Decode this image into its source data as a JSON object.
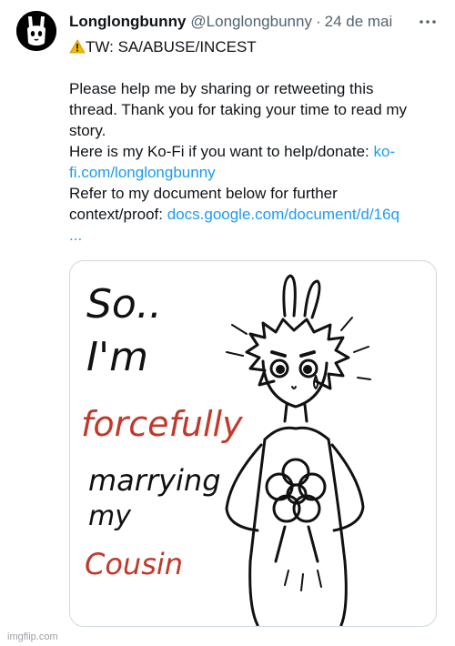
{
  "tweet": {
    "display_name": "Longlongbunny",
    "handle": "@Longlongbunny",
    "separator": "·",
    "date": "24 de mai",
    "warning_icon": "warning-icon",
    "warning_text": "TW: SA/ABUSE/INCEST",
    "lines": {
      "l1": "Please help me by sharing or retweeting this",
      "l2": "thread. Thank you for taking your time to read my",
      "l3": "story.",
      "l4_text": "Here is my Ko-Fi if you want to help/donate: ",
      "l4_link": "ko-",
      "l5_link": "fi.com/longlongbunny",
      "l6": "Refer to my document below for further",
      "l7_text": "context/proof: ",
      "l7_link": "docs.google.com/document/d/16q",
      "l8_link": "..."
    }
  },
  "media": {
    "text_lines": [
      "So..",
      "I'm",
      "forcefully",
      "marrying",
      "my",
      "Cousin"
    ],
    "accent_color": "#c0392b"
  },
  "colors": {
    "link": "#1d9bf0",
    "muted": "#536471",
    "border": "#cfd9de"
  },
  "watermark": "imgflip.com"
}
